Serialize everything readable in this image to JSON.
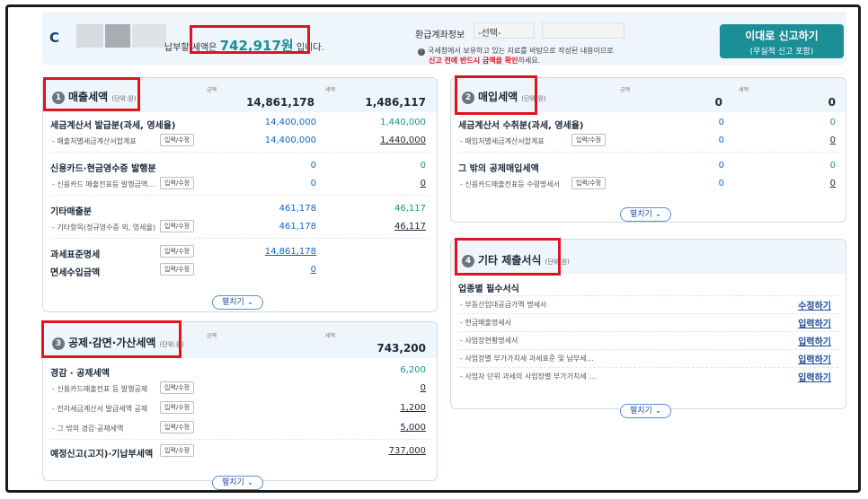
{
  "summary": {
    "logo": "C",
    "text_prefix": "납부할 세액은",
    "amount": "742,917원",
    "text_suffix": "입니다."
  },
  "refund": {
    "label": "환급계좌정보",
    "select_value": "-선택-",
    "notice_line1": "국세청에서 보유하고 있는 자료를 바탕으로 작성된 내용이므로",
    "notice_red": "신고 전에 반드시 금액을 확인",
    "notice_end": "하세요."
  },
  "report_button": {
    "line1": "이대로 신고하기",
    "line2": "(무실적 신고 포함)"
  },
  "common": {
    "unit": "(단위:원)",
    "amount_caption": "금액",
    "tax_caption": "세액",
    "edit_label": "입력/수정",
    "expand_label": "펼치기"
  },
  "sales": {
    "num": "1",
    "title": "매출세액",
    "total_amount": "14,861,178",
    "total_tax": "1,486,117",
    "rows": {
      "invoice": {
        "label": "세금계산서 발급분(과세, 영세율)",
        "amount": "14,400,000",
        "tax": "1,440,000"
      },
      "invoice_sub": {
        "label": "- 매출처별세금계산서합계표",
        "amount": "14,400,000",
        "tax": "1,440,000"
      },
      "card": {
        "label": "신용카드·현금영수증 발행분",
        "amount": "0",
        "tax": "0"
      },
      "card_sub": {
        "label": "- 신용카드 매출전표등 발행금액…",
        "amount": "0",
        "tax": "0"
      },
      "other": {
        "label": "기타매출분",
        "amount": "461,178",
        "tax": "46,117"
      },
      "other_sub": {
        "label": "- 기타항목(정규영수증 외, 영세율)",
        "amount": "461,178",
        "tax": "46,117"
      },
      "base": {
        "label": "과세표준명세",
        "amount": "14,861,178"
      },
      "exempt": {
        "label": "면세수입금액",
        "amount": "0"
      }
    }
  },
  "purchase": {
    "num": "2",
    "title": "매입세액",
    "total_amount": "0",
    "total_tax": "0",
    "rows": {
      "invoice": {
        "label": "세금계산서 수취분(과세, 영세율)",
        "amount": "0",
        "tax": "0"
      },
      "invoice_sub": {
        "label": "- 매입처별세금계산서합계표",
        "amount": "0",
        "tax": "0"
      },
      "other": {
        "label": "그 밖의 공제매입세액",
        "amount": "0",
        "tax": "0"
      },
      "other_sub": {
        "label": "- 신용카드매출전표등 수령명세서",
        "amount": "0",
        "tax": "0"
      }
    }
  },
  "deduction": {
    "num": "3",
    "title": "공제·감면·가산세액",
    "total_tax": "743,200",
    "rows": {
      "reduce": {
        "label": "경감 · 공제세액",
        "tax": "6,200"
      },
      "card": {
        "label": "- 신용카드매출전표 등 발행공제",
        "tax": "0"
      },
      "einvoice": {
        "label": "- 전자세금계산서 발급세액 공제",
        "tax": "1,200"
      },
      "other": {
        "label": "- 그 밖의 경감·공제세액",
        "tax": "5,000"
      },
      "prepaid": {
        "label": "예정신고(고지)·기납부세액",
        "tax": "737,000"
      }
    }
  },
  "forms": {
    "num": "4",
    "title": "기타 제출서식",
    "section": "업종별 필수서식",
    "items": [
      {
        "label": "- 부동산임대공급가액 명세서",
        "action": "수정하기"
      },
      {
        "label": "- 현금매출명세서",
        "action": "입력하기"
      },
      {
        "label": "- 사업장현황명세서",
        "action": "입력하기"
      },
      {
        "label": "- 사업장별 부가가치세 과세표준 및 납부세…",
        "action": "입력하기"
      },
      {
        "label": "- 사업자 단위 과세의 사업장별 부가가치세 …",
        "action": "입력하기"
      }
    ]
  }
}
